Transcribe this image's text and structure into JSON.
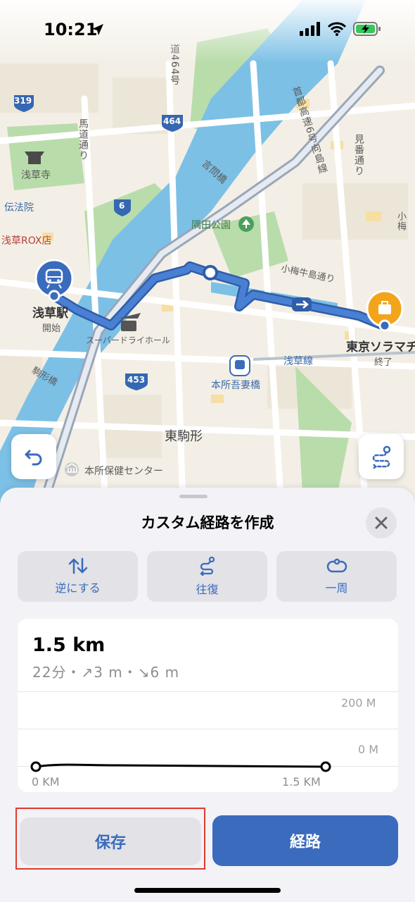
{
  "status_bar": {
    "time": "10:21",
    "icons": [
      "location-arrow-icon",
      "signal-icon",
      "wifi-icon",
      "battery-charging-icon"
    ]
  },
  "map": {
    "road_labels": {
      "route_319": "319",
      "route_464": "464",
      "route_6": "6",
      "route_453": "453",
      "road_464_vertical": "道464号",
      "umamichi": "馬道通り",
      "kototoi": "言問橋",
      "shutoko": "首都高速6号向島線",
      "kenban": "見番通り",
      "komume_ushijima": "小梅牛島通り",
      "komume": "小梅",
      "asakusa_line": "浅草線",
      "komagatabashi": "駒形橋"
    },
    "place_labels": {
      "sensoji": "浅草寺",
      "denpoin": "伝法院",
      "asakusa_rox": "浅草ROX店",
      "sumida_park": "隅田公園",
      "super_dry_hall": "スーパードライホール",
      "honjo_azumabashi": "本所吾妻橋",
      "higashi_komagata": "東駒形",
      "honjo_health_center": "本所保健センター"
    },
    "start": {
      "name": "浅草駅",
      "tag": "開始"
    },
    "end": {
      "name": "東京ソラマチ",
      "tag": "終了"
    }
  },
  "map_buttons": {
    "undo": "undo-icon",
    "route_options": "custom-route-icon"
  },
  "sheet": {
    "title": "カスタム経路を作成",
    "options": [
      {
        "label": "逆にする",
        "icon": "reverse-arrows-icon"
      },
      {
        "label": "往復",
        "icon": "round-trip-icon"
      },
      {
        "label": "一周",
        "icon": "loop-icon"
      }
    ],
    "distance": "1.5 km",
    "details": "22分・↗3 m・↘6 m",
    "elevation": {
      "top_label": "200 M",
      "bottom_label": "0 M",
      "x_start": "0 KM",
      "x_end": "1.5 KM"
    },
    "save_label": "保存",
    "route_label": "経路"
  },
  "colors": {
    "accent": "#3a6bbd",
    "route_line": "#3f73c9",
    "highlight": "#e03a2f",
    "water": "#7cc0e6",
    "park": "#b9dcab"
  }
}
